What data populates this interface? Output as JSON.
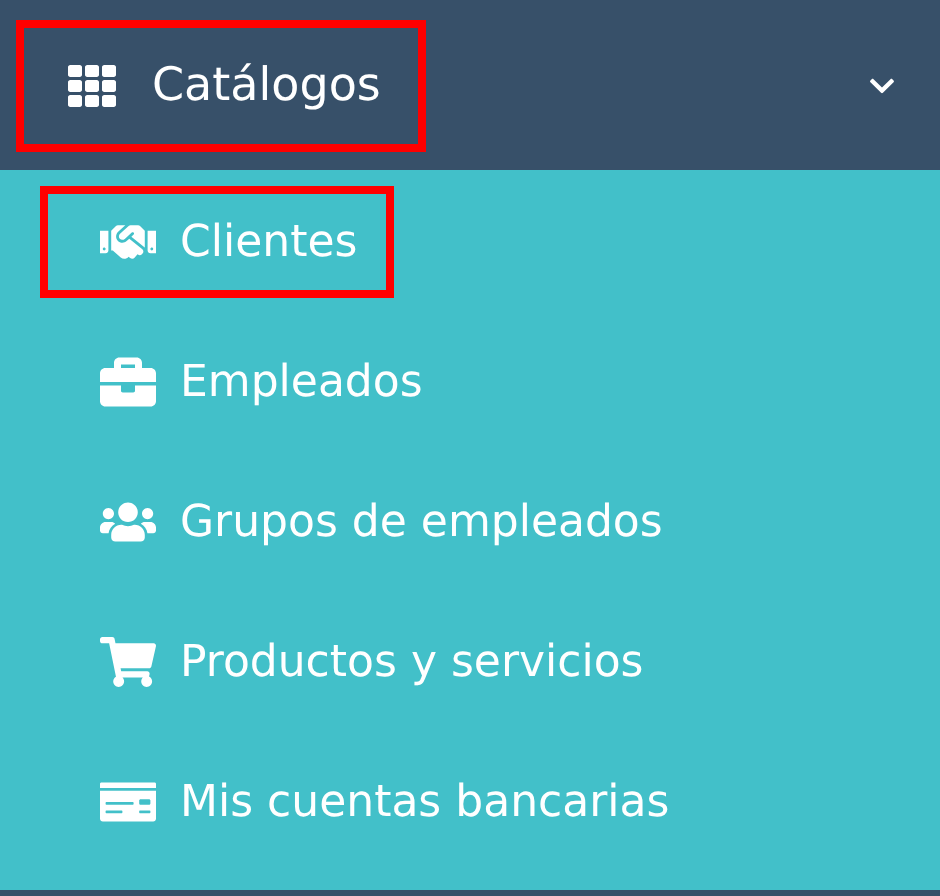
{
  "menu": {
    "label": "Catálogos",
    "expanded": true,
    "highlighted": true,
    "items": [
      {
        "label": "Clientes",
        "highlighted": true
      },
      {
        "label": "Empleados",
        "highlighted": false
      },
      {
        "label": "Grupos de empleados",
        "highlighted": false
      },
      {
        "label": "Productos y servicios",
        "highlighted": false
      },
      {
        "label": "Mis cuentas bancarias",
        "highlighted": false
      }
    ]
  }
}
